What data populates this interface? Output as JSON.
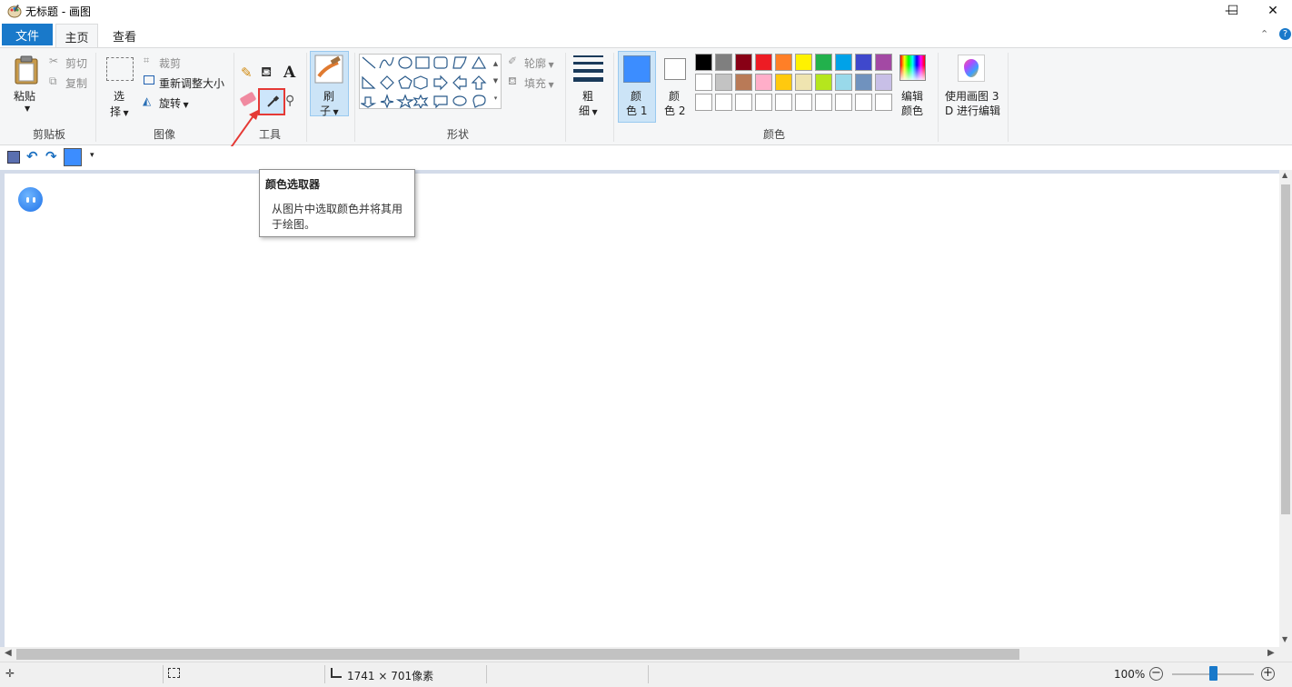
{
  "window": {
    "title": "无标题 - 画图",
    "controls": {
      "minimize": "—",
      "maximize": "☐",
      "close": "✕"
    }
  },
  "tabs": {
    "file": "文件",
    "home": "主页",
    "view": "查看"
  },
  "ribbon": {
    "clipboard": {
      "paste": "粘贴",
      "cut": "剪切",
      "copy": "复制",
      "group_label": "剪贴板"
    },
    "image": {
      "select_1": "选",
      "select_2": "择",
      "crop": "裁剪",
      "resize": "重新调整大小",
      "rotate": "旋转",
      "group_label": "图像"
    },
    "tools": {
      "group_label": "工具",
      "text_glyph": "A"
    },
    "brushes": {
      "label_1": "刷",
      "label_2": "子"
    },
    "shapes": {
      "outline": "轮廓",
      "fill": "填充",
      "group_label": "形状"
    },
    "size": {
      "label_1": "粗",
      "label_2": "细"
    },
    "colors": {
      "color1_1": "颜",
      "color1_2": "色 1",
      "color2_1": "颜",
      "color2_2": "色 2",
      "edit_1": "编辑",
      "edit_2": "颜色",
      "group_label": "颜色",
      "color1_value": "#3c8dff",
      "color2_value": "#ffffff",
      "palette_row1": [
        "#000000",
        "#7f7f7f",
        "#880015",
        "#ed1c24",
        "#ff7f27",
        "#fff200",
        "#22b14c",
        "#00a2e8",
        "#3f48cc",
        "#a349a4"
      ],
      "palette_row2": [
        "#ffffff",
        "#c3c3c3",
        "#b97a57",
        "#ffaec9",
        "#ffc90e",
        "#efe4b0",
        "#b5e61d",
        "#99d9ea",
        "#7092be",
        "#c8bfe7"
      ],
      "palette_row3": [
        "#ffffff",
        "#ffffff",
        "#ffffff",
        "#ffffff",
        "#ffffff",
        "#ffffff",
        "#ffffff",
        "#ffffff",
        "#ffffff",
        "#ffffff"
      ]
    },
    "paint3d": {
      "label_1": "使用画图 3",
      "label_2": "D 进行编辑"
    }
  },
  "tooltip": {
    "title": "颜色选取器",
    "line1": "从图片中选取颜色并将其用",
    "line2": "于绘图。"
  },
  "status": {
    "dimensions": "1741 × 701像素",
    "zoom": "100%",
    "zoom_level": 0.5
  }
}
